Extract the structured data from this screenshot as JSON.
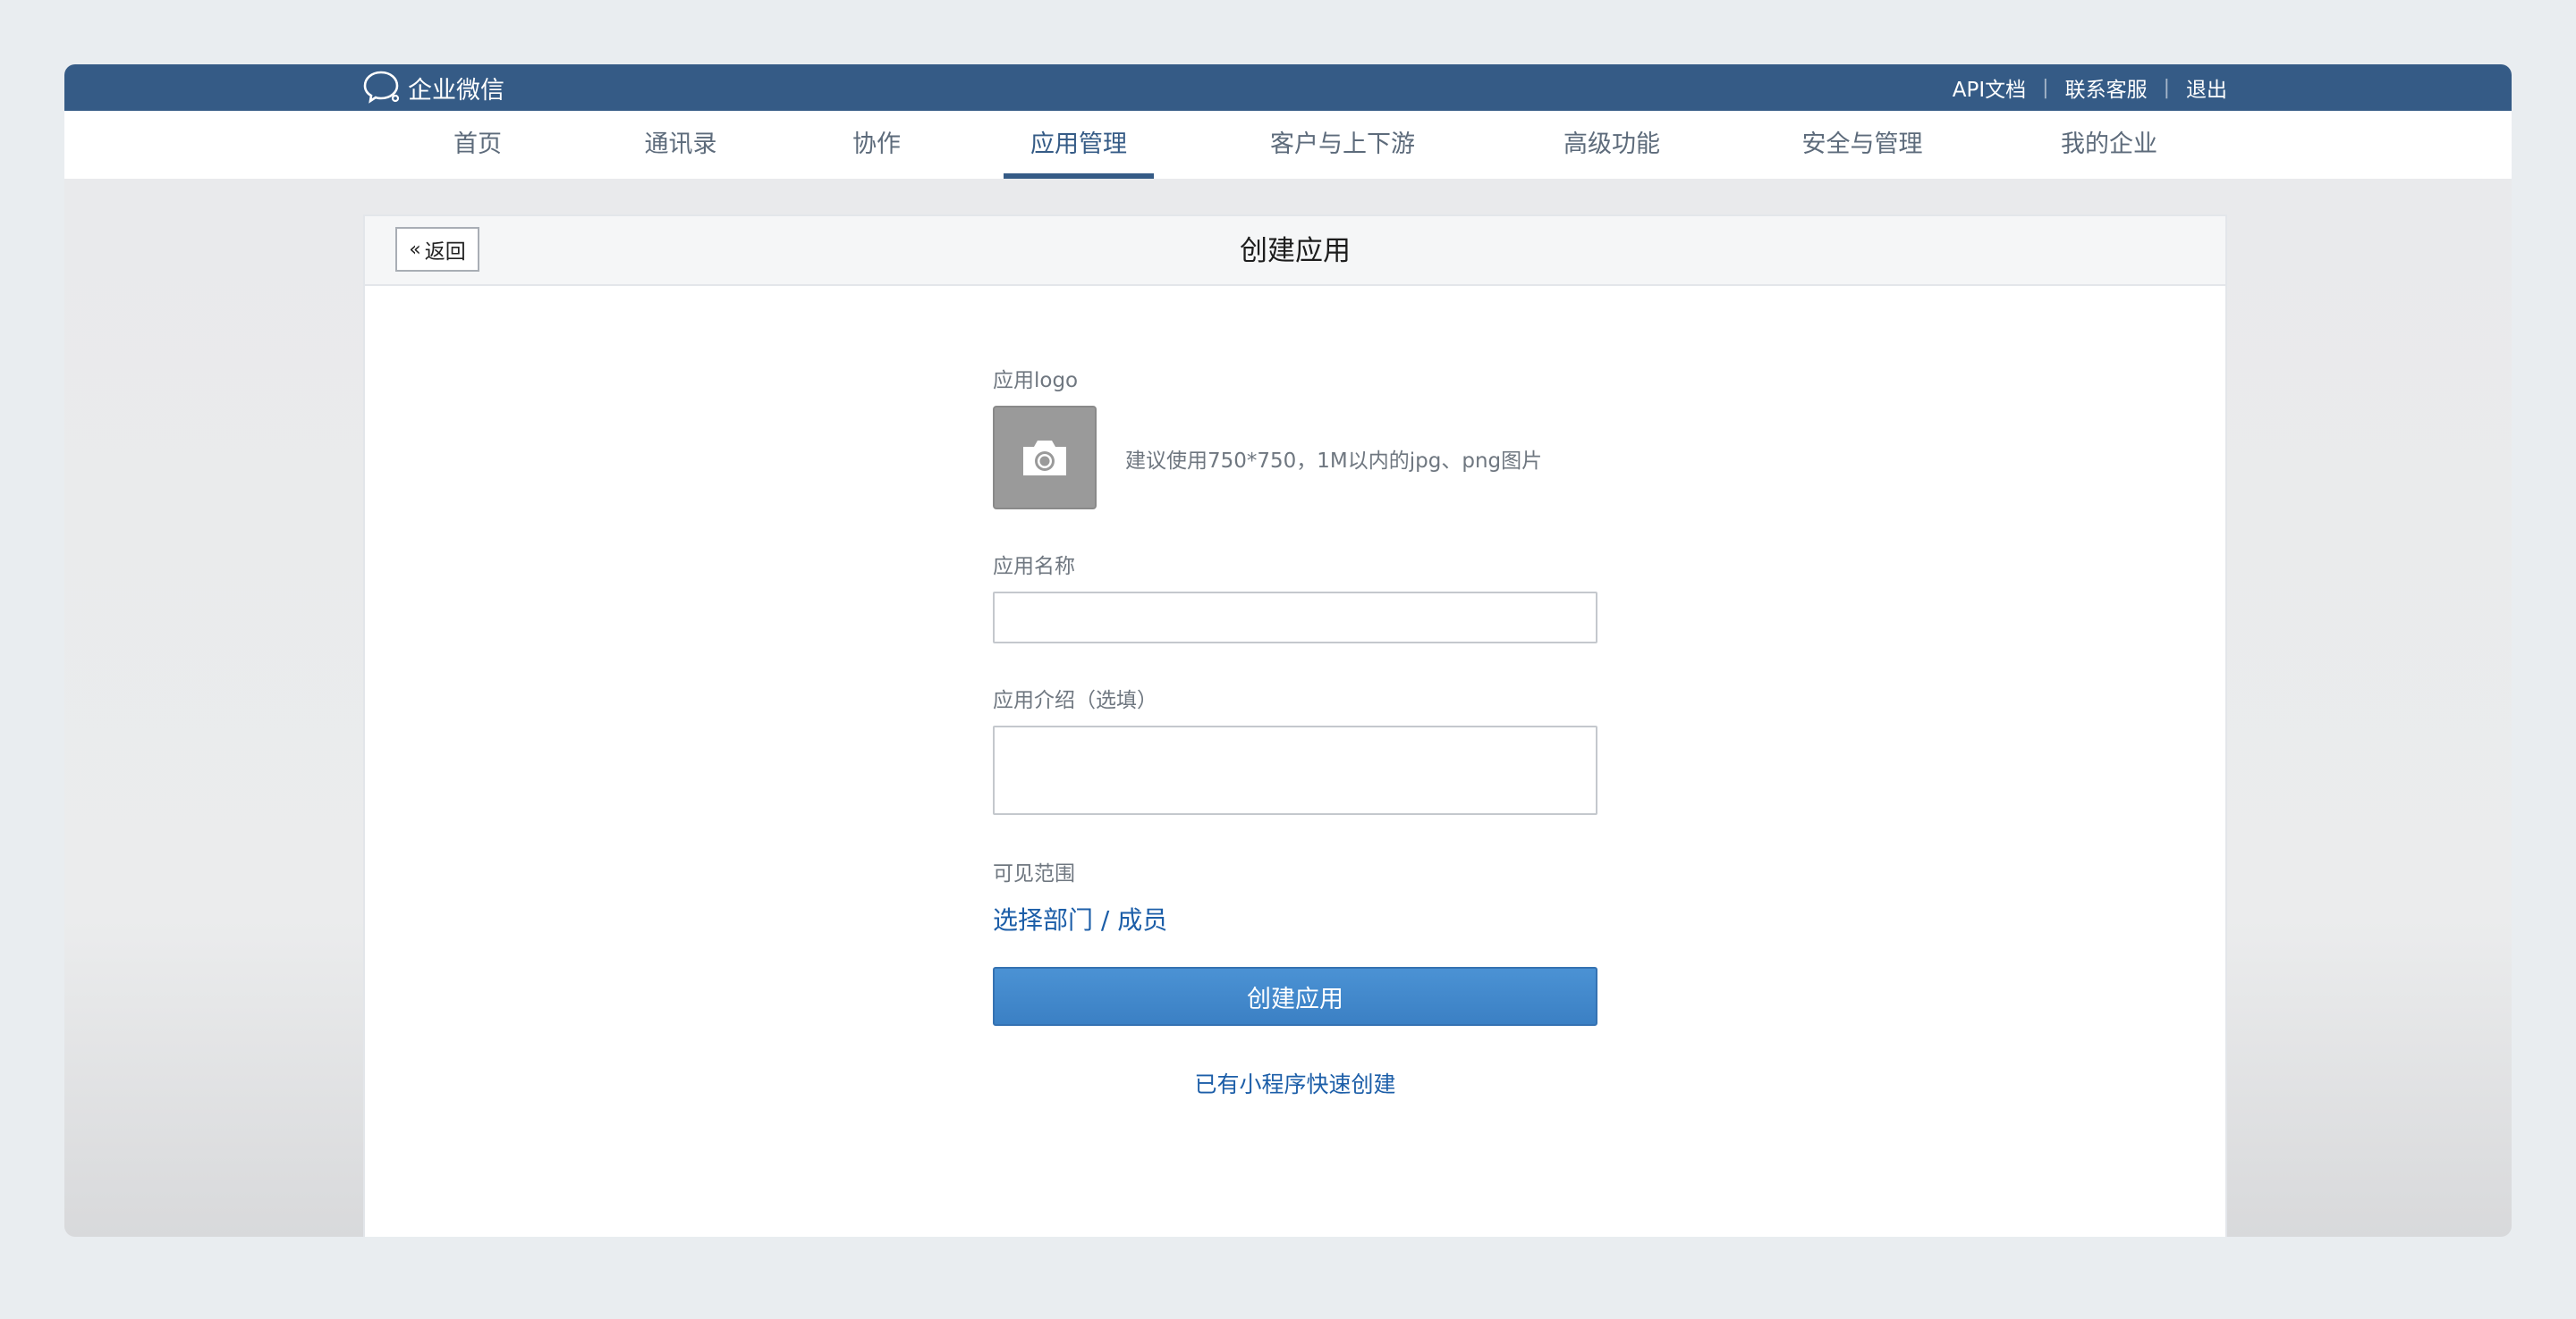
{
  "header": {
    "brand": "企业微信",
    "links": [
      {
        "label": "API文档"
      },
      {
        "label": "联系客服"
      },
      {
        "label": "退出"
      }
    ]
  },
  "nav": {
    "items": [
      {
        "label": "首页"
      },
      {
        "label": "通讯录"
      },
      {
        "label": "协作"
      },
      {
        "label": "应用管理"
      },
      {
        "label": "客户与上下游"
      },
      {
        "label": "高级功能"
      },
      {
        "label": "安全与管理"
      },
      {
        "label": "我的企业"
      }
    ],
    "active": "应用管理"
  },
  "page": {
    "back_label": "返回",
    "title": "创建应用"
  },
  "form": {
    "logo_label": "应用logo",
    "logo_hint": "建议使用750*750，1M以内的jpg、png图片",
    "name_label": "应用名称",
    "name_value": "",
    "intro_label": "应用介绍（选填）",
    "intro_value": "",
    "scope_label": "可见范围",
    "scope_link": "选择部门 / 成员",
    "submit_label": "创建应用",
    "mini_program_link": "已有小程序快速创建"
  },
  "icons": {
    "brand": "chat-bubble-icon",
    "logo_upload": "camera-icon",
    "back": "double-chevron-left-icon"
  },
  "colors": {
    "header_bg": "#355b86",
    "primary": "#3b80c4",
    "link": "#1c5ea8"
  }
}
